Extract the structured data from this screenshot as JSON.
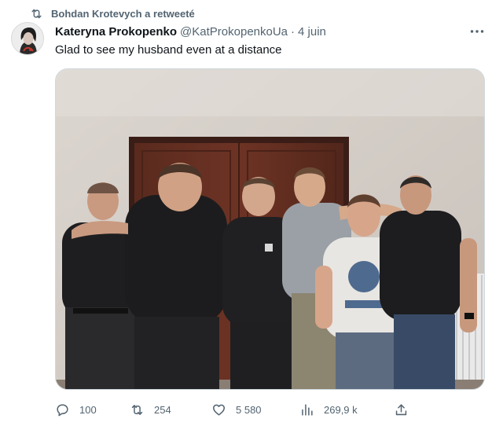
{
  "social_context": {
    "icon": "retweet-icon",
    "text": "Bohdan Krotevych a retweeté"
  },
  "author": {
    "display_name": "Kateryna Prokopenko",
    "handle": "@KatProkopenkoUa",
    "separator": "·",
    "date": "4 juin"
  },
  "tweet": {
    "text": "Glad to see my husband even at a distance"
  },
  "more_icon": "more-horizontal-icon",
  "actions": {
    "replies": "100",
    "retweets": "254",
    "likes": "5 580",
    "views": "269,9 k"
  },
  "icons": {
    "reply": "reply-icon",
    "retweet": "retweet-icon",
    "like": "heart-icon",
    "views": "views-bar-chart-icon",
    "share": "share-icon"
  },
  "colors": {
    "secondary_text": "#536471",
    "primary_text": "#0f1419",
    "border": "#cfd9de"
  }
}
